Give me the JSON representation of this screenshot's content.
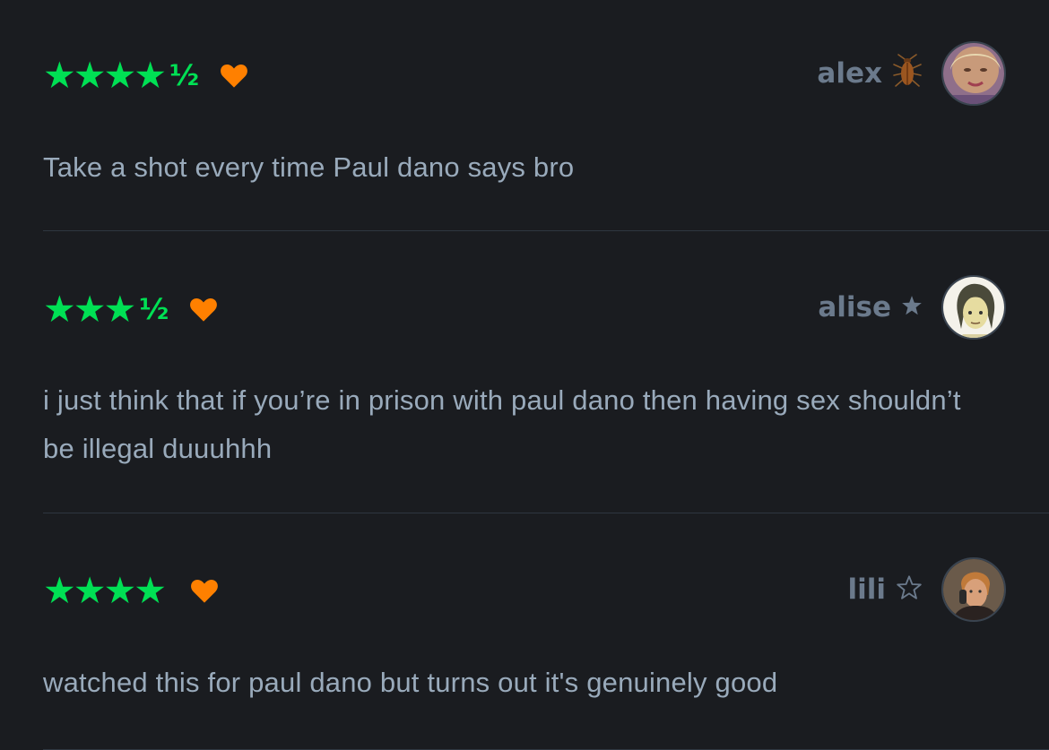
{
  "reviews": [
    {
      "stars": "★★★★",
      "half": "½",
      "liked": true,
      "username": "alex",
      "badge_icon": "cockroach-icon",
      "text": "Take a shot every time Paul dano says bro"
    },
    {
      "stars": "★★★",
      "half": "½",
      "liked": true,
      "username": "alise",
      "badge_icon": "star-icon",
      "text": "i just think that if you’re in prison with paul dano then having sex shouldn’t be illegal duuuhhh"
    },
    {
      "stars": "★★★★",
      "half": "",
      "liked": true,
      "username": "lili",
      "badge_icon": "star-outline-icon",
      "text": "watched this for paul dano but turns out it's genuinely good"
    }
  ],
  "colors": {
    "background": "#1a1c20",
    "star_green": "#00e054",
    "heart_orange": "#ff8000",
    "username": "#6b7a8c",
    "body_text": "#99aabb"
  }
}
